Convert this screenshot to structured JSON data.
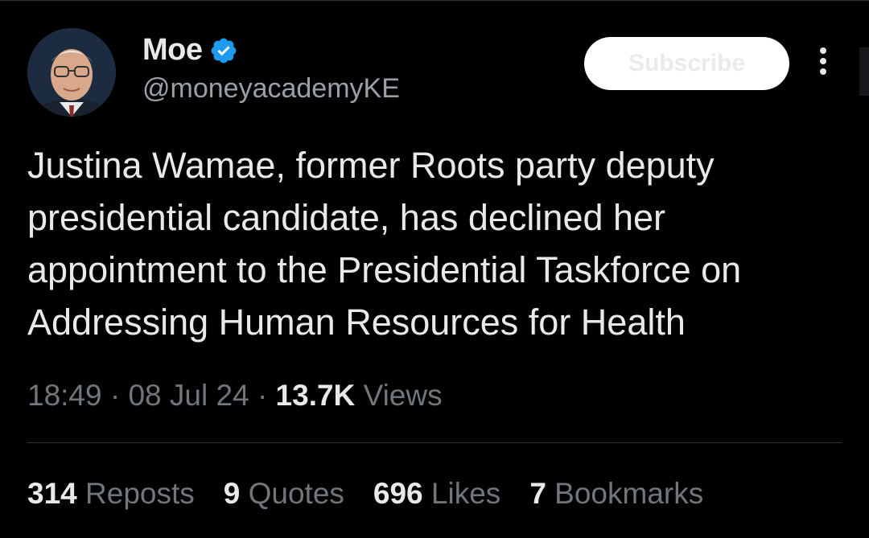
{
  "author": {
    "name": "Moe",
    "handle": "@moneyacademyKE"
  },
  "actions": {
    "subscribe_label": "Subscribe"
  },
  "tweet": {
    "text": "Justina Wamae, former Roots party deputy presidential candidate, has declined her appointment to the Presidential Taskforce on Addressing Human Resources for Health",
    "time": "18:49",
    "date": "08 Jul 24",
    "separator": "·",
    "views_count": "13.7K",
    "views_label": "Views"
  },
  "stats": [
    {
      "count": "314",
      "label": "Reposts"
    },
    {
      "count": "9",
      "label": "Quotes"
    },
    {
      "count": "696",
      "label": "Likes"
    },
    {
      "count": "7",
      "label": "Bookmarks"
    }
  ],
  "colors": {
    "background": "#000000",
    "text": "#e7e9ea",
    "secondary": "#71767b",
    "verified": "#1d9bf0",
    "divider": "#2f3336"
  }
}
